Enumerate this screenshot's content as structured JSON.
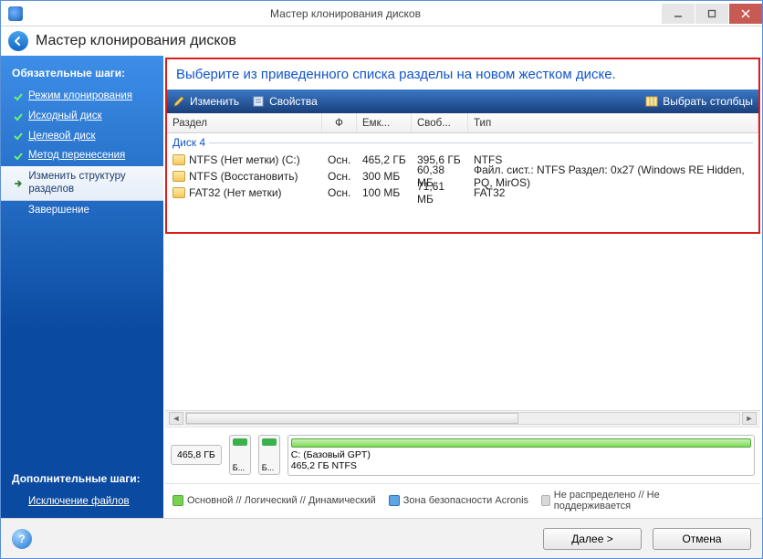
{
  "window": {
    "title": "Мастер клонирования дисков"
  },
  "header": {
    "title": "Мастер клонирования дисков"
  },
  "sidebar": {
    "section1": "Обязательные шаги:",
    "steps": [
      {
        "label": "Режим клонирования",
        "state": "done"
      },
      {
        "label": "Исходный диск",
        "state": "done"
      },
      {
        "label": "Целевой диск",
        "state": "done"
      },
      {
        "label": "Метод перенесения",
        "state": "done"
      },
      {
        "label": "Изменить структуру разделов",
        "state": "current"
      },
      {
        "label": "Завершение",
        "state": "upcoming"
      }
    ],
    "section2": "Дополнительные шаги:",
    "extra": [
      {
        "label": "Исключение файлов"
      }
    ]
  },
  "main": {
    "instruction": "Выберите из приведенного списка разделы на новом жестком диске.",
    "toolbar": {
      "edit": "Изменить",
      "props": "Свойства",
      "columns": "Выбрать столбцы"
    },
    "grid": {
      "headers": {
        "partition": "Раздел",
        "flag": "Ф",
        "capacity": "Емк...",
        "free": "Своб...",
        "type": "Тип"
      },
      "disk_label": "Диск 4",
      "rows": [
        {
          "name": "NTFS (Нет метки) (C:)",
          "flag": "Осн.",
          "cap": "465,2 ГБ",
          "free": "395,6 ГБ",
          "type": "NTFS"
        },
        {
          "name": "NTFS (Восстановить)",
          "flag": "Осн.",
          "cap": "300 МБ",
          "free": "60,38 МБ",
          "type": "Файл. сист.: NTFS Раздел: 0x27 (Windows RE Hidden, PQ, MirOS)"
        },
        {
          "name": "FAT32 (Нет метки)",
          "flag": "Осн.",
          "cap": "100 МБ",
          "free": "71,61 МБ",
          "type": "FAT32"
        }
      ]
    },
    "disk_strip": {
      "total": "465,8 ГБ",
      "seg_small_1": "Б...",
      "seg_small_2": "Б...",
      "main_line1": "C: (Базовый GPT)",
      "main_line2": "465,2 ГБ  NTFS"
    },
    "legend": {
      "primary": "Основной // Логический // Динамический",
      "secure": "Зона безопасности Acronis",
      "unalloc": "Не распределено // Не поддерживается"
    }
  },
  "footer": {
    "next": "Далее >",
    "cancel": "Отмена"
  }
}
